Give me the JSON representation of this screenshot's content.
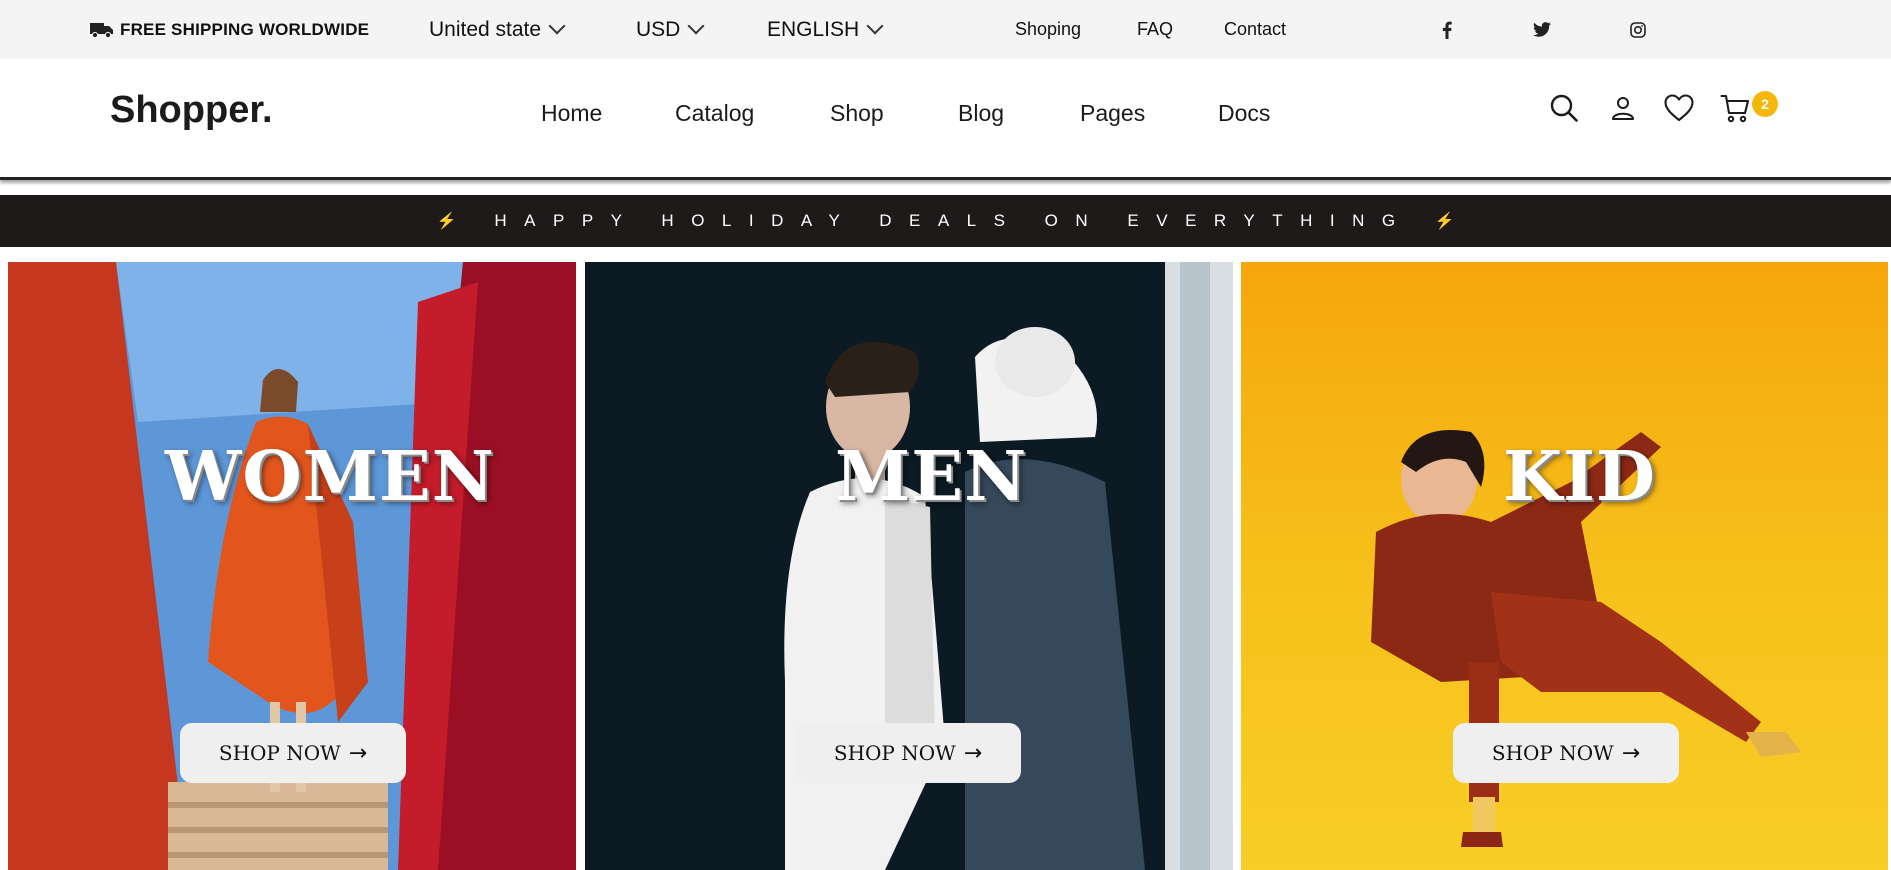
{
  "topbar": {
    "shipping": "FREE SHIPPING WORLDWIDE",
    "country": "United state",
    "currency": "USD",
    "language": "ENGLISH",
    "links": [
      "Shoping",
      "FAQ",
      "Contact"
    ],
    "social_icons": [
      "facebook-icon",
      "twitter-icon",
      "instagram-icon"
    ]
  },
  "header": {
    "logo": "Shopper.",
    "nav": [
      "Home",
      "Catalog",
      "Shop",
      "Blog",
      "Pages",
      "Docs"
    ],
    "icons": [
      "search-icon",
      "user-icon",
      "heart-icon",
      "cart-icon"
    ],
    "cart_count": "2"
  },
  "promo": {
    "text": "HAPPY HOLIDAY DEALS ON EVERYTHING",
    "bolt": "⚡"
  },
  "categories": [
    {
      "title": "WOMEN",
      "button": "SHOP NOW"
    },
    {
      "title": "MEN",
      "button": "SHOP NOW"
    },
    {
      "title": "KID",
      "button": "SHOP NOW"
    }
  ],
  "colors": {
    "accent": "#f5b80a",
    "promo_bg": "#1e1a1a",
    "topbar_bg": "#f4f4f4"
  }
}
